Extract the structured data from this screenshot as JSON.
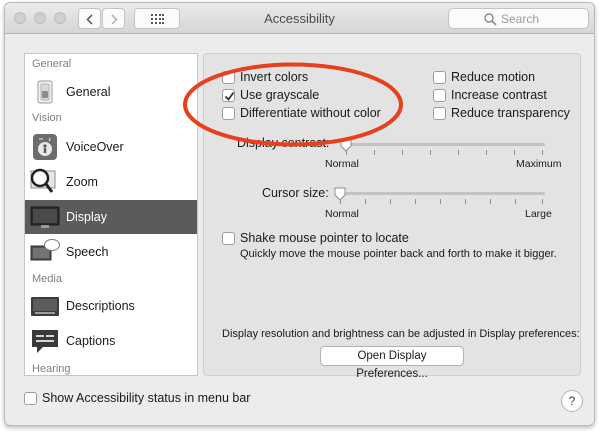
{
  "window": {
    "title": "Accessibility"
  },
  "search": {
    "placeholder": "Search"
  },
  "sidebar": {
    "categories": {
      "general": "General",
      "vision": "Vision",
      "media": "Media",
      "hearing": "Hearing"
    },
    "items": [
      {
        "label": "General",
        "selected": false
      },
      {
        "label": "VoiceOver",
        "selected": false
      },
      {
        "label": "Zoom",
        "selected": false
      },
      {
        "label": "Display",
        "selected": true
      },
      {
        "label": "Speech",
        "selected": false
      },
      {
        "label": "Descriptions",
        "selected": false
      },
      {
        "label": "Captions",
        "selected": false
      }
    ]
  },
  "display": {
    "options_left": [
      {
        "label": "Invert colors",
        "checked": false
      },
      {
        "label": "Use grayscale",
        "checked": true
      },
      {
        "label": "Differentiate without color",
        "checked": false
      }
    ],
    "options_right": [
      {
        "label": "Reduce motion",
        "checked": false
      },
      {
        "label": "Increase contrast",
        "checked": false
      },
      {
        "label": "Reduce transparency",
        "checked": false
      }
    ],
    "contrast": {
      "label": "Display contrast:",
      "min_label": "Normal",
      "max_label": "Maximum",
      "value": 0
    },
    "cursor": {
      "label": "Cursor size:",
      "min_label": "Normal",
      "max_label": "Large",
      "value": 0
    },
    "shake": {
      "label": "Shake mouse pointer to locate",
      "description": "Quickly move the mouse pointer back and forth to make it bigger.",
      "checked": false
    },
    "resolution_hint": "Display resolution and brightness can be adjusted in Display preferences:",
    "open_prefs_button": "Open Display Preferences..."
  },
  "footer": {
    "status_label": "Show Accessibility status in menu bar",
    "status_checked": false,
    "help": "?"
  },
  "colors": {
    "selected_bg": "#5b5b5b",
    "annotation": "#e8401c"
  }
}
